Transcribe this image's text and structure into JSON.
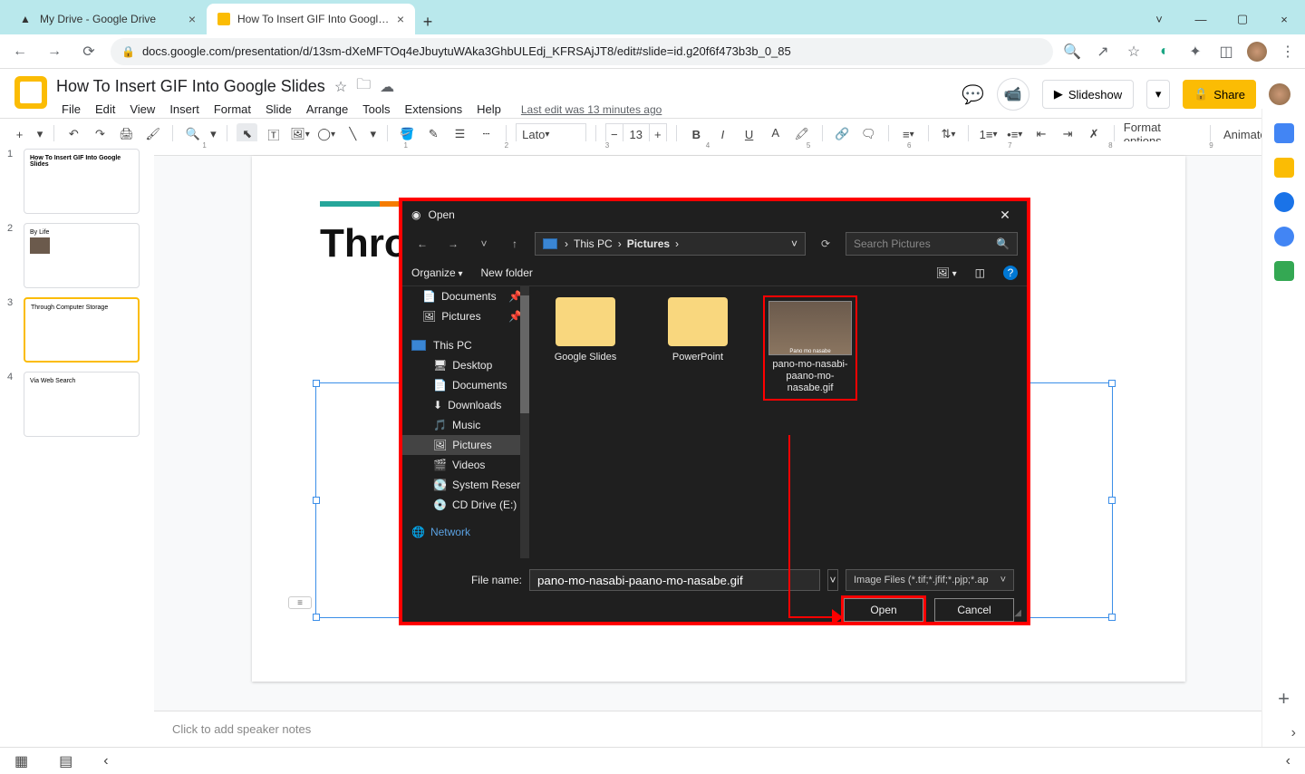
{
  "browser": {
    "tabs": [
      {
        "title": "My Drive - Google Drive"
      },
      {
        "title": "How To Insert GIF Into Google Sl"
      }
    ],
    "url": "docs.google.com/presentation/d/13sm-dXeMFTOq4eJbuytuWAka3GhbULEdj_KFRSAjJT8/edit#slide=id.g20f6f473b3b_0_85"
  },
  "doc": {
    "title": "How To Insert GIF Into Google Slides",
    "last_edit": "Last edit was 13 minutes ago"
  },
  "menu": [
    "File",
    "Edit",
    "View",
    "Insert",
    "Format",
    "Slide",
    "Arrange",
    "Tools",
    "Extensions",
    "Help"
  ],
  "header": {
    "slideshow": "Slideshow",
    "share": "Share"
  },
  "toolbar": {
    "font": "Lato",
    "font_size": "13",
    "format_options": "Format options",
    "animate": "Animate"
  },
  "ruler": [
    "1",
    "",
    "1",
    "2",
    "3",
    "4",
    "5",
    "6",
    "7",
    "8",
    "9"
  ],
  "thumbnails": [
    {
      "num": "1",
      "text": "How To Insert GIF Into Google Slides"
    },
    {
      "num": "2",
      "text": "By Life"
    },
    {
      "num": "3",
      "text": "Through Computer Storage"
    },
    {
      "num": "4",
      "text": "Via Web Search"
    }
  ],
  "slide": {
    "title": "Throu"
  },
  "speaker_notes_placeholder": "Click to add speaker notes",
  "dialog": {
    "window_title": "Open",
    "path_root": "This PC",
    "path_folder": "Pictures",
    "search_placeholder": "Search Pictures",
    "organize": "Organize",
    "new_folder": "New folder",
    "tree": {
      "documents": "Documents",
      "pictures": "Pictures",
      "this_pc": "This PC",
      "desktop": "Desktop",
      "documents2": "Documents",
      "downloads": "Downloads",
      "music": "Music",
      "pictures2": "Pictures",
      "videos": "Videos",
      "system_reserved": "System Reserved",
      "cd_drive": "CD Drive (E:)",
      "network": "Network"
    },
    "files": [
      {
        "name": "Google Slides"
      },
      {
        "name": "PowerPoint"
      },
      {
        "name": "pano-mo-nasabi-paano-mo-nasabe.gif"
      }
    ],
    "file_name_label": "File name:",
    "file_name_value": "pano-mo-nasabi-paano-mo-nasabe.gif",
    "filter": "Image Files (*.tif;*.jfif;*.pjp;*.ap",
    "open": "Open",
    "cancel": "Cancel"
  }
}
